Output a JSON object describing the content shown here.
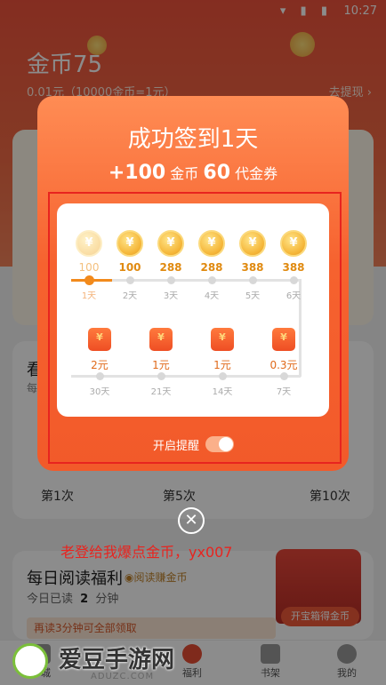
{
  "status_bar": {
    "time": "10:27"
  },
  "header": {
    "coin_title": "金币75",
    "rate": "0.01元（10000金币=1元）",
    "withdraw": "去提现 ›"
  },
  "video_card": {
    "title": "看",
    "subtitle": "每"
  },
  "rounds": [
    "第1次",
    "第5次",
    "第10次"
  ],
  "read_card": {
    "title": "每日阅读福利",
    "badge": "◉阅读赚金币",
    "sub_prefix": "今日已读",
    "minutes": "2",
    "sub_suffix": "分钟",
    "more": "再读3分钟可全部领取",
    "chest_label": "开宝箱得金币"
  },
  "tabs": [
    {
      "label": "书城"
    },
    {
      "label": "福利"
    },
    {
      "label": "书架"
    },
    {
      "label": "我的"
    }
  ],
  "modal": {
    "title": "成功签到1天",
    "reward_plus": "+100",
    "reward_coin_word": "金币",
    "reward_coupon_count": "60",
    "reward_coupon_word": "代金券",
    "coin_symbol": "¥",
    "coins": [
      {
        "amount": "100",
        "day": "1天",
        "done": true
      },
      {
        "amount": "100",
        "day": "2天",
        "done": false
      },
      {
        "amount": "288",
        "day": "3天",
        "done": false
      },
      {
        "amount": "288",
        "day": "4天",
        "done": false
      },
      {
        "amount": "388",
        "day": "5天",
        "done": false
      },
      {
        "amount": "388",
        "day": "6天",
        "done": false
      }
    ],
    "coupons": [
      {
        "amount": "2元",
        "day": "30天"
      },
      {
        "amount": "1元",
        "day": "21天"
      },
      {
        "amount": "1元",
        "day": "14天"
      },
      {
        "amount": "0.3元",
        "day": "7天"
      }
    ],
    "remind_label": "开启提醒",
    "remind_on": true,
    "close_symbol": "✕"
  },
  "promo_text": "老登给我爆点金币，yx007",
  "watermark": {
    "name": "爱豆手游网",
    "url": "ADUZC.COM"
  },
  "colors": {
    "accent": "#f25a2a",
    "coin": "#f5b73a",
    "frame": "#e8241f"
  }
}
